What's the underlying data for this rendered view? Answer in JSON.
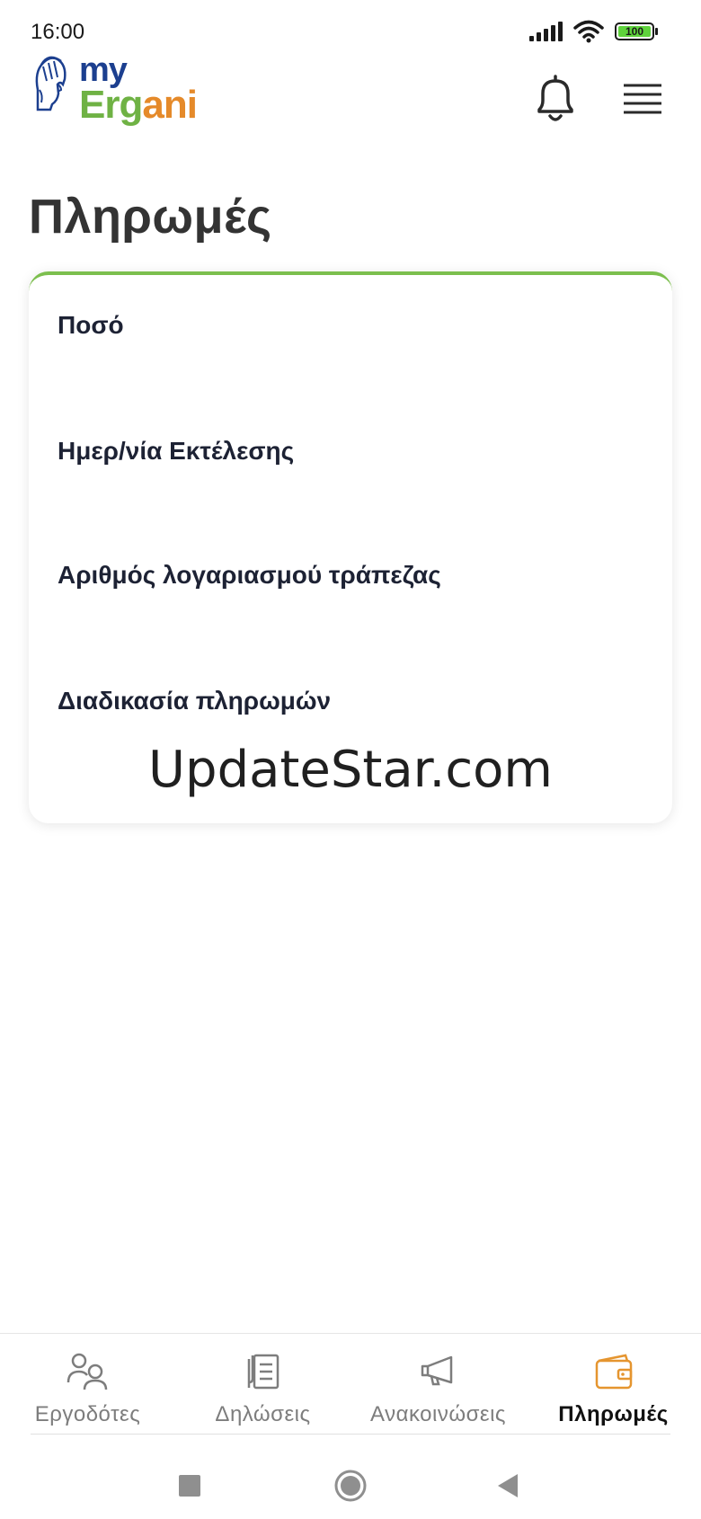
{
  "status_bar": {
    "time": "16:00",
    "battery_label": "100",
    "icons": [
      "signal-icon",
      "wifi-icon",
      "battery-icon"
    ]
  },
  "header": {
    "logo_my": "my",
    "logo_ergani_1": "Erg",
    "logo_ergani_2": "ani",
    "icons": [
      "helmet-logo-icon",
      "bell-icon",
      "hamburger-menu-icon"
    ]
  },
  "page": {
    "title": "Πληρωμές"
  },
  "card": {
    "fields": [
      "Ποσό",
      "Ημερ/νία Εκτέλεσης",
      "Αριθμός λογαριασμού τράπεζας",
      "Διαδικασία πληρωμών"
    ],
    "watermark": "UpdateStar.com"
  },
  "bottom_nav": {
    "items": [
      {
        "label": "Εργοδότες",
        "icon": "users-icon",
        "active": false
      },
      {
        "label": "Δηλώσεις",
        "icon": "documents-icon",
        "active": false
      },
      {
        "label": "Ανακοινώσεις",
        "icon": "megaphone-icon",
        "active": false
      },
      {
        "label": "Πληρωμές",
        "icon": "wallet-icon",
        "active": true
      }
    ]
  },
  "colors": {
    "brand_blue": "#1c3f8f",
    "brand_green": "#6fb244",
    "brand_orange": "#e58a2a",
    "card_accent": "#7cbf4e",
    "active_icon": "#e5952f"
  },
  "system_nav": {
    "icons": [
      "recents-square-icon",
      "home-circle-icon",
      "back-triangle-icon"
    ]
  }
}
